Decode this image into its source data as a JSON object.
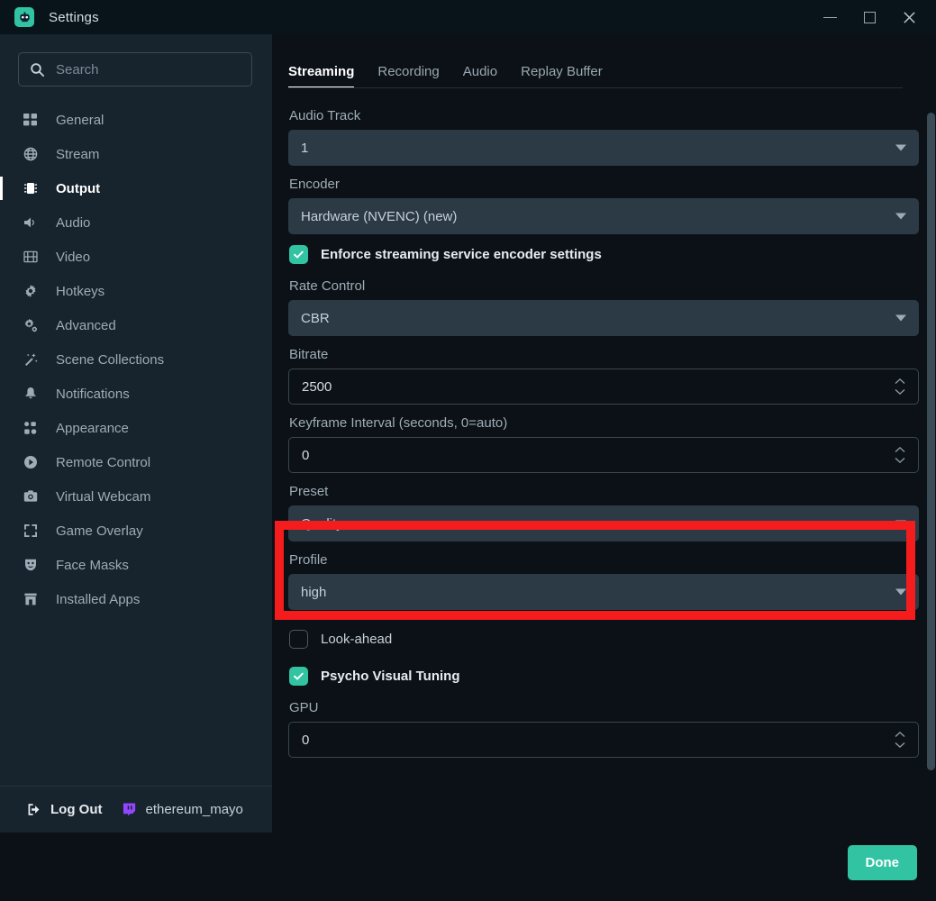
{
  "window": {
    "title": "Settings",
    "logo_icon": "streamlabs-logo-icon",
    "minimize_label": "Minimize",
    "maximize_label": "Maximize",
    "close_label": "Close",
    "accent_color": "#31c3a2"
  },
  "search": {
    "placeholder": "Search",
    "value": "",
    "icon": "search-icon"
  },
  "sidebar": {
    "items": [
      {
        "label": "General",
        "icon": "grid-icon",
        "active": false
      },
      {
        "label": "Stream",
        "icon": "globe-icon",
        "active": false
      },
      {
        "label": "Output",
        "icon": "chip-icon",
        "active": true
      },
      {
        "label": "Audio",
        "icon": "speaker-icon",
        "active": false
      },
      {
        "label": "Video",
        "icon": "film-icon",
        "active": false
      },
      {
        "label": "Hotkeys",
        "icon": "gear-icon",
        "active": false
      },
      {
        "label": "Advanced",
        "icon": "gears-icon",
        "active": false
      },
      {
        "label": "Scene Collections",
        "icon": "wand-icon",
        "active": false
      },
      {
        "label": "Notifications",
        "icon": "bell-icon",
        "active": false
      },
      {
        "label": "Appearance",
        "icon": "appearance-icon",
        "active": false
      },
      {
        "label": "Remote Control",
        "icon": "play-circle-icon",
        "active": false
      },
      {
        "label": "Virtual Webcam",
        "icon": "camera-icon",
        "active": false
      },
      {
        "label": "Game Overlay",
        "icon": "expand-icon",
        "active": false
      },
      {
        "label": "Face Masks",
        "icon": "mask-icon",
        "active": false
      },
      {
        "label": "Installed Apps",
        "icon": "store-icon",
        "active": false
      }
    ],
    "footer": {
      "logout_label": "Log Out",
      "logout_icon": "logout-icon",
      "account_name": "ethereum_mayo",
      "platform_icon": "twitch-icon",
      "platform_color": "#9146ff"
    }
  },
  "main": {
    "tabs": [
      {
        "label": "Streaming",
        "active": true
      },
      {
        "label": "Recording",
        "active": false
      },
      {
        "label": "Audio",
        "active": false
      },
      {
        "label": "Replay Buffer",
        "active": false
      }
    ],
    "fields": [
      {
        "id": "audio-track",
        "label": "Audio Track",
        "type": "select",
        "value": "1"
      },
      {
        "id": "encoder",
        "label": "Encoder",
        "type": "select",
        "value": "Hardware (NVENC) (new)"
      },
      {
        "id": "enforce-encoder",
        "label": "Enforce streaming service encoder settings",
        "type": "checkbox",
        "checked": true
      },
      {
        "id": "rate-control",
        "label": "Rate Control",
        "type": "select",
        "value": "CBR"
      },
      {
        "id": "bitrate",
        "label": "Bitrate",
        "type": "spinner",
        "value": "2500"
      },
      {
        "id": "keyframe-interval",
        "label": "Keyframe Interval (seconds, 0=auto)",
        "type": "spinner",
        "value": "0"
      },
      {
        "id": "preset",
        "label": "Preset",
        "type": "select",
        "value": "Quality",
        "highlighted": true
      },
      {
        "id": "profile",
        "label": "Profile",
        "type": "select",
        "value": "high"
      },
      {
        "id": "look-ahead",
        "label": "Look-ahead",
        "type": "checkbox",
        "checked": false
      },
      {
        "id": "psycho-visual",
        "label": "Psycho Visual Tuning",
        "type": "checkbox",
        "checked": true
      },
      {
        "id": "gpu",
        "label": "GPU",
        "type": "spinner",
        "value": "0"
      }
    ],
    "done_label": "Done"
  },
  "annotation": {
    "color": "#f41c1c",
    "targets": "preset"
  }
}
